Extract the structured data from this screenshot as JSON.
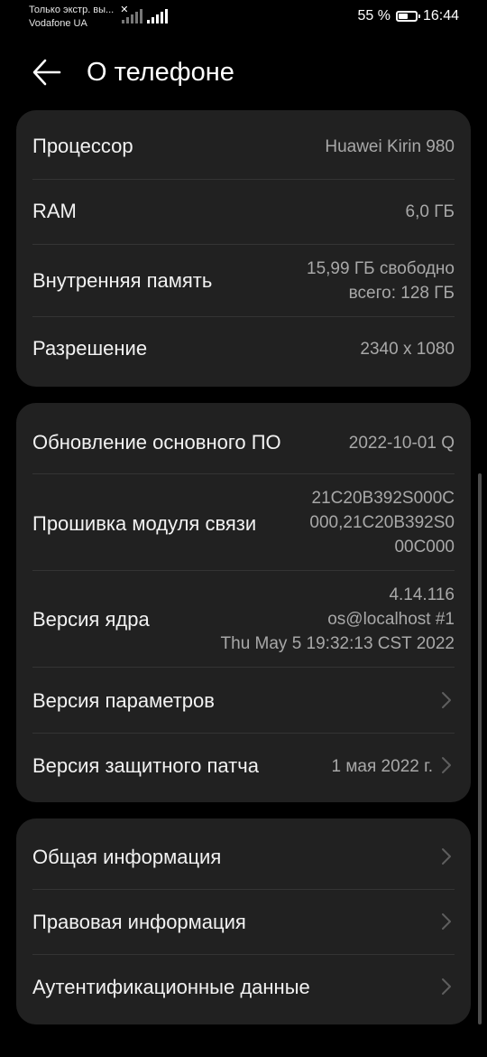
{
  "status_bar": {
    "notification_text": "Только экстр. вы...",
    "carrier": "Vodafone UA",
    "battery_percent": "55 %",
    "battery_level": 0.55,
    "time": "16:44"
  },
  "header": {
    "title": "О телефоне",
    "back_icon": "arrow-left-icon"
  },
  "hardware": {
    "processor_label": "Процессор",
    "processor_value": "Huawei Kirin 980",
    "ram_label": "RAM",
    "ram_value": "6,0  ГБ",
    "storage_label": "Внутренняя память",
    "storage_free": "15,99  ГБ свободно",
    "storage_total": "всего: 128  ГБ",
    "resolution_label": "Разрешение",
    "resolution_value": "2340 x 1080"
  },
  "software": {
    "base_update_label": "Обновление основного ПО",
    "base_update_value": "2022-10-01 Q",
    "baseband_label": "Прошивка модуля связи",
    "baseband_line1": "21C20B392S000C",
    "baseband_line2": "000,21C20B392S0",
    "baseband_line3": "00C000",
    "kernel_label": "Версия ядра",
    "kernel_line1": "4.14.116",
    "kernel_line2": "os@localhost #1",
    "kernel_line3": "Thu May 5 19:32:13 CST 2022",
    "params_label": "Версия параметров",
    "security_patch_label": "Версия защитного патча",
    "security_patch_value": "1 мая 2022 г."
  },
  "info": {
    "general_label": "Общая информация",
    "legal_label": "Правовая информация",
    "auth_label": "Аутентификационные данные"
  },
  "colors": {
    "background": "#000000",
    "card": "#212121",
    "secondary_text": "#a8a8a8"
  }
}
